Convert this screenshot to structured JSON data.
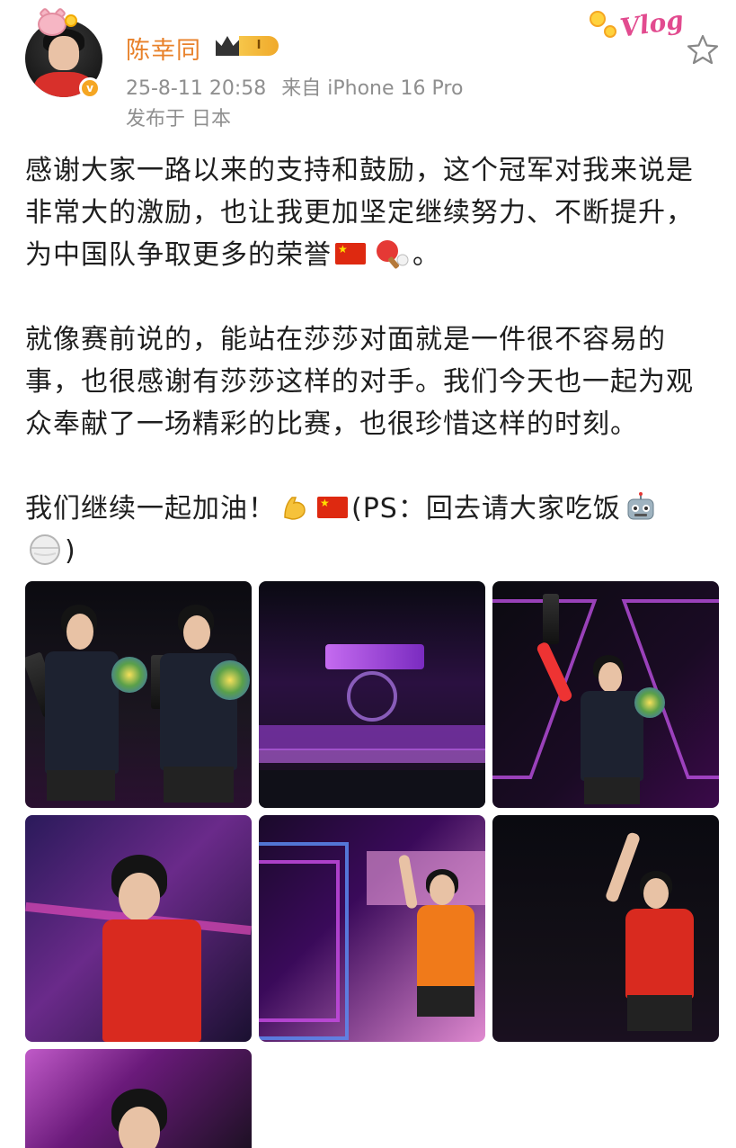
{
  "user": {
    "name": "陈幸同",
    "level_badge": "I",
    "verified_mark": "v",
    "timestamp": "25-8-11 20:58",
    "source": "来自 iPhone 16 Pro",
    "location": "发布于 日本"
  },
  "decoration": {
    "label": "Vlog"
  },
  "post": {
    "paragraph1": {
      "text": "感谢大家一路以来的支持和鼓励，这个冠军对我来说是非常大的激励，也让我更加坚定继续努力、不断提升，为中国队争取更多的荣誉",
      "end": "。"
    },
    "paragraph2": "就像赛前说的，能站在莎莎对面就是一件很不容易的事，也很感谢有莎莎这样的对手。我们今天也一起为观众奉献了一场精彩的比赛，也很珍惜这样的时刻。",
    "paragraph3": {
      "start": "我们继续一起加油！",
      "middle": "(PS：回去请大家吃饭",
      "end": ")"
    }
  },
  "icons": {
    "star": "star-icon",
    "flag": "china-flag-icon",
    "paddle": "table-tennis-icon",
    "muscle": "flexed-biceps-icon",
    "robot": "robot-icon",
    "ball": "ball-icon"
  },
  "photos": [
    {
      "id": "photo-1",
      "desc": "two players on podium holding trophies"
    },
    {
      "id": "photo-2",
      "desc": "arena stage wide shot"
    },
    {
      "id": "photo-3",
      "desc": "player raising trophy"
    },
    {
      "id": "photo-4",
      "desc": "player in red shirt close-up"
    },
    {
      "id": "photo-5",
      "desc": "player in orange shirt celebrating"
    },
    {
      "id": "photo-6",
      "desc": "player in red shirt waving"
    },
    {
      "id": "photo-7",
      "desc": "player partially visible"
    }
  ],
  "colors": {
    "username": "#e8812a",
    "meta": "#8f8f8f",
    "text": "#1e1e1e"
  }
}
